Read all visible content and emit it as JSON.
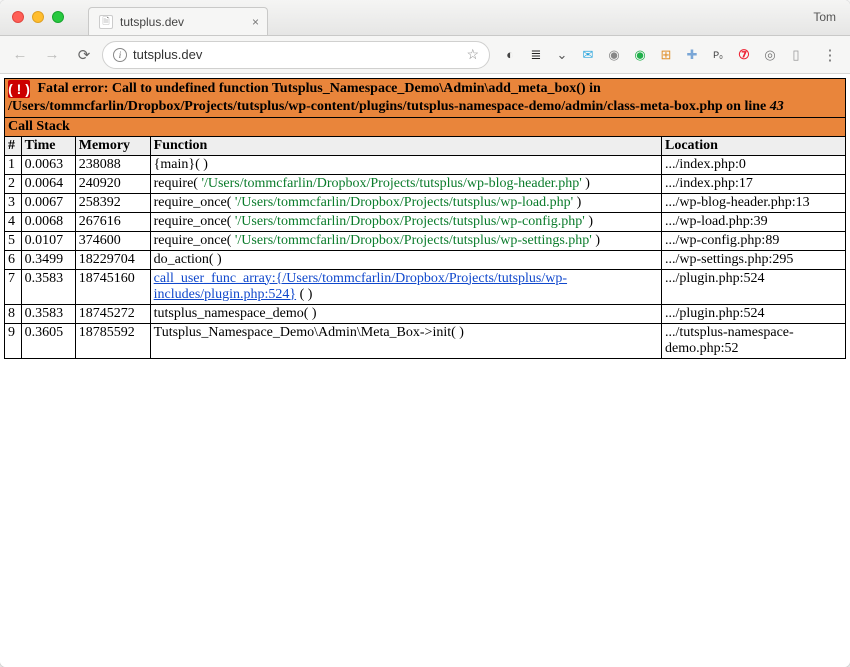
{
  "window": {
    "profile_name": "Tom",
    "tab_title": "tutsplus.dev"
  },
  "toolbar": {
    "url": "tutsplus.dev"
  },
  "error": {
    "banner_prefix": "Fatal error: ",
    "banner_msg": "Call to undefined function Tutsplus_Namespace_Demo\\Admin\\add_meta_box() in /Users/tommcfarlin/Dropbox/Projects/tutsplus/wp-content/plugins/tutsplus-namespace-demo/admin/class-meta-box.php on line ",
    "banner_line": "43",
    "call_stack_label": "Call Stack",
    "headers": {
      "n": "#",
      "time": "Time",
      "memory": "Memory",
      "function": "Function",
      "location": "Location"
    },
    "rows": [
      {
        "n": "1",
        "time": "0.0063",
        "memory": "238088",
        "fn_pre": "{main}( )",
        "fn_path": "",
        "fn_post": "",
        "loc": ".../index.php:0"
      },
      {
        "n": "2",
        "time": "0.0064",
        "memory": "240920",
        "fn_pre": "require( ",
        "fn_path": "'/Users/tommcfarlin/Dropbox/Projects/tutsplus/wp-blog-header.php'",
        "fn_post": " )",
        "loc": ".../index.php:17"
      },
      {
        "n": "3",
        "time": "0.0067",
        "memory": "258392",
        "fn_pre": "require_once( ",
        "fn_path": "'/Users/tommcfarlin/Dropbox/Projects/tutsplus/wp-load.php'",
        "fn_post": " )",
        "loc": ".../wp-blog-header.php:13"
      },
      {
        "n": "4",
        "time": "0.0068",
        "memory": "267616",
        "fn_pre": "require_once( ",
        "fn_path": "'/Users/tommcfarlin/Dropbox/Projects/tutsplus/wp-config.php'",
        "fn_post": " )",
        "loc": ".../wp-load.php:39"
      },
      {
        "n": "5",
        "time": "0.0107",
        "memory": "374600",
        "fn_pre": "require_once( ",
        "fn_path": "'/Users/tommcfarlin/Dropbox/Projects/tutsplus/wp-settings.php'",
        "fn_post": " )",
        "loc": ".../wp-config.php:89"
      },
      {
        "n": "6",
        "time": "0.3499",
        "memory": "18229704",
        "fn_pre": "do_action( )",
        "fn_path": "",
        "fn_post": "",
        "loc": ".../wp-settings.php:295"
      },
      {
        "n": "7",
        "time": "0.3583",
        "memory": "18745160",
        "fn_link": "call_user_func_array:{/Users/tommcfarlin/Dropbox/Projects/tutsplus/wp-includes/plugin.php:524}",
        "fn_post": " ( )",
        "loc": ".../plugin.php:524"
      },
      {
        "n": "8",
        "time": "0.3583",
        "memory": "18745272",
        "fn_pre": "tutsplus_namespace_demo( )",
        "fn_path": "",
        "fn_post": "",
        "loc": ".../plugin.php:524"
      },
      {
        "n": "9",
        "time": "0.3605",
        "memory": "18785592",
        "fn_pre": "Tutsplus_Namespace_Demo\\Admin\\Meta_Box->init( )",
        "fn_path": "",
        "fn_post": "",
        "loc": ".../tutsplus-namespace-demo.php:52"
      }
    ]
  },
  "colors": {
    "banner_bg": "#e9853b",
    "path_green": "#0a7b2b",
    "link_blue": "#1048cc"
  }
}
